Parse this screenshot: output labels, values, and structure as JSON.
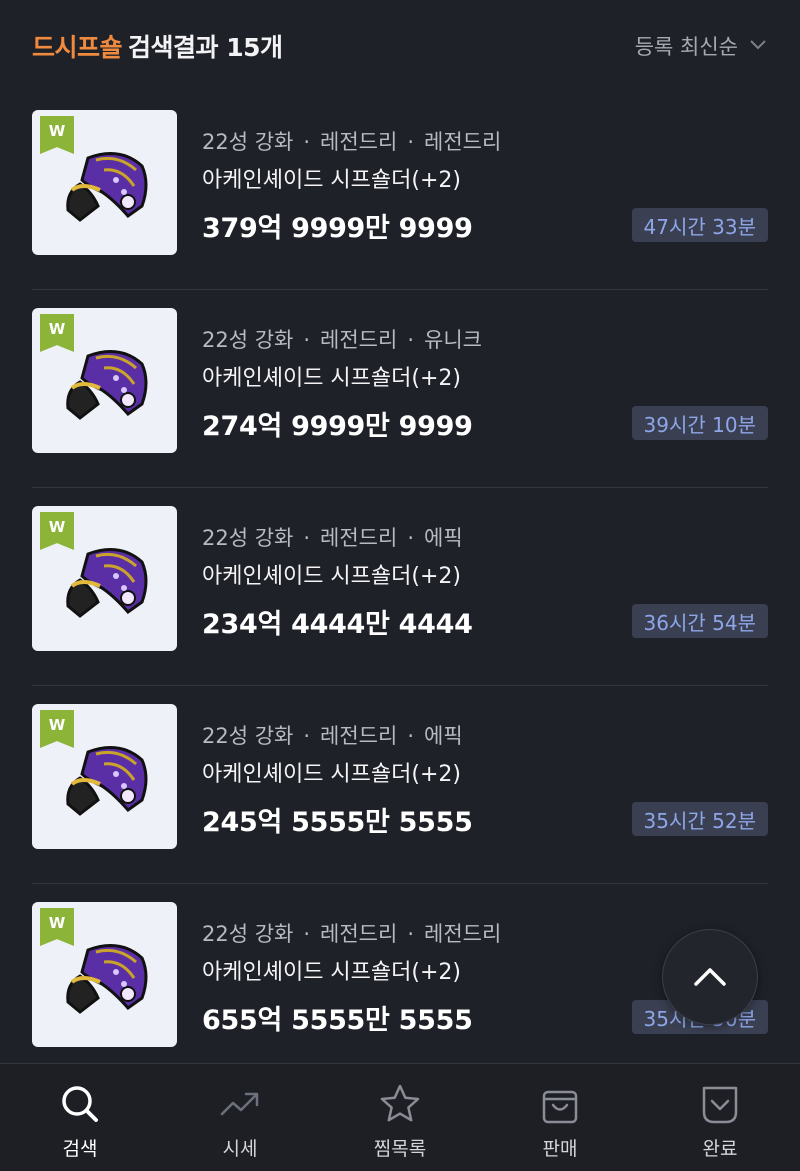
{
  "header": {
    "keyword": "드시프숄",
    "result_text": "검색결과 15개",
    "sort_label": "등록 최신순"
  },
  "items": [
    {
      "badge": "W",
      "tags": [
        "22성 강화",
        "레전드리",
        "레전드리"
      ],
      "name": "아케인셰이드 시프숄더(+2)",
      "price": "379억 9999만 9999",
      "time": "47시간 33분"
    },
    {
      "badge": "W",
      "tags": [
        "22성 강화",
        "레전드리",
        "유니크"
      ],
      "name": "아케인셰이드 시프숄더(+2)",
      "price": "274억 9999만 9999",
      "time": "39시간 10분"
    },
    {
      "badge": "W",
      "tags": [
        "22성 강화",
        "레전드리",
        "에픽"
      ],
      "name": "아케인셰이드 시프숄더(+2)",
      "price": "234억 4444만 4444",
      "time": "36시간 54분"
    },
    {
      "badge": "W",
      "tags": [
        "22성 강화",
        "레전드리",
        "에픽"
      ],
      "name": "아케인셰이드 시프숄더(+2)",
      "price": "245억 5555만 5555",
      "time": "35시간 52분"
    },
    {
      "badge": "W",
      "tags": [
        "22성 강화",
        "레전드리",
        "레전드리"
      ],
      "name": "아케인셰이드 시프숄더(+2)",
      "price": "655억 5555만 5555",
      "time": "35시간 50분"
    }
  ],
  "tag_separator": "·",
  "nav": [
    {
      "label": "검색",
      "icon": "search-icon",
      "active": true
    },
    {
      "label": "시세",
      "icon": "trend-icon",
      "active": false
    },
    {
      "label": "찜목록",
      "icon": "star-icon",
      "active": false
    },
    {
      "label": "판매",
      "icon": "bag-icon",
      "active": false
    },
    {
      "label": "완료",
      "icon": "check-box-icon",
      "active": false
    }
  ],
  "colors": {
    "background": "#1f2128",
    "keyword": "#ef8a3e",
    "time_badge_bg": "#3a4052",
    "time_badge_text": "#8ea6e8",
    "grade_badge": "#8bb438"
  }
}
